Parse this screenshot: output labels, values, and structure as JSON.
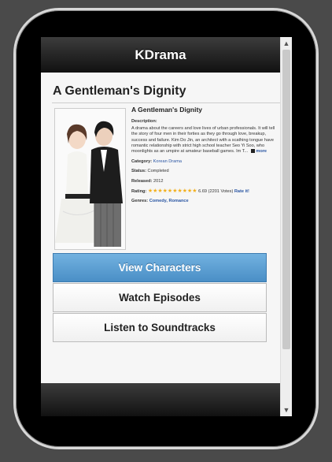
{
  "app": {
    "title": "KDrama"
  },
  "drama": {
    "title": "A Gentleman's Dignity",
    "info_title": "A Gentleman's Dignity",
    "description_label": "Description:",
    "description": "A drama about the careers and love lives of urban professionals. It will tell the story of four men in their forties as they go through love, breakup, success and failure. Kim Do Jin, an architect with a scathing tongue have romantic relationship with strict high school teacher Seo Yi Soo, who moonlights as an umpire at amateur baseball games. Im T...",
    "more_label": "more",
    "category_label": "Category:",
    "category": "Korean Drama",
    "status_label": "Status:",
    "status": "Completed",
    "released_label": "Released:",
    "released": "2012",
    "rating_label": "Rating:",
    "rating_value": "6.69",
    "votes": "(2201 Votes)",
    "rate_it": "Rate it!",
    "genres_label": "Genres:",
    "genres": "Comedy, Romance"
  },
  "buttons": {
    "view_characters": "View Characters",
    "watch_episodes": "Watch Episodes",
    "listen_soundtracks": "Listen to Soundtracks"
  },
  "colors": {
    "primary_button": "#4a8fc6",
    "header": "#1a1a1a",
    "link": "#2a56a3",
    "star": "#f2b01e"
  },
  "scrollbar": {
    "up": "▲",
    "down": "▼"
  },
  "stars": "★★★★★★★★★★"
}
